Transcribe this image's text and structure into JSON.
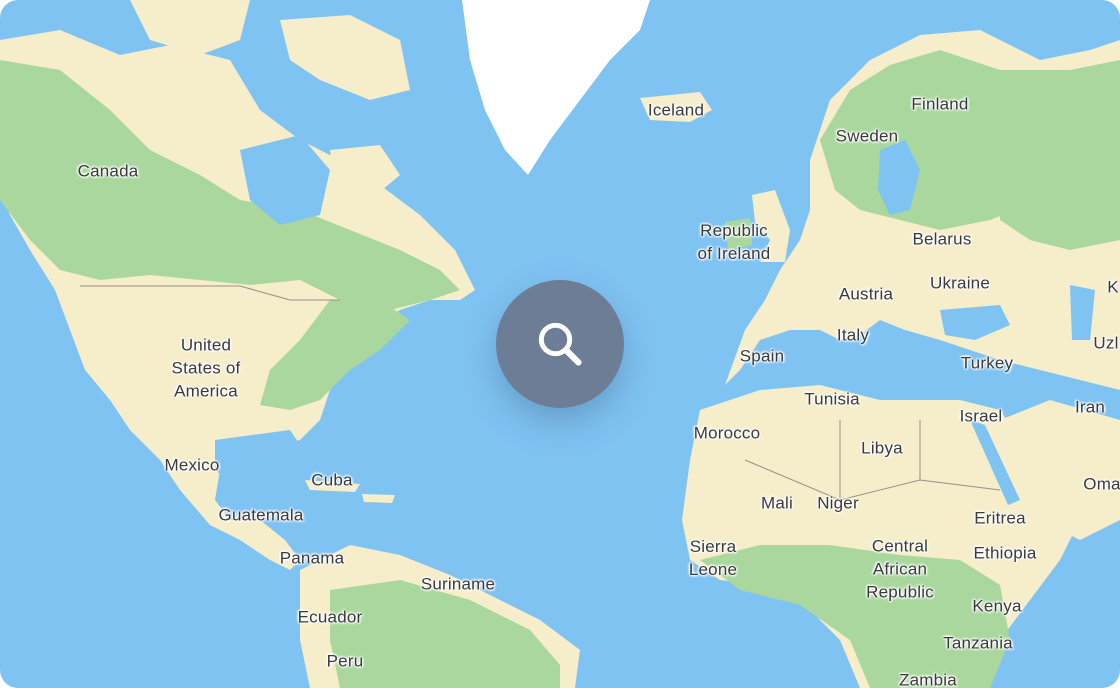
{
  "colors": {
    "ocean": "#7fc3f3",
    "land_green": "#a9d79e",
    "land_sand": "#f6edcb",
    "ice": "#ffffff",
    "search_button": "#6d7d95"
  },
  "search_button": {
    "icon": "search-icon"
  },
  "labels": {
    "canada": "Canada",
    "usa": "United\nStates of\nAmerica",
    "mexico": "Mexico",
    "cuba": "Cuba",
    "guatemala": "Guatemala",
    "panama": "Panama",
    "suriname": "Suriname",
    "ecuador": "Ecuador",
    "peru": "Peru",
    "iceland": "Iceland",
    "ireland": "Republic\nof Ireland",
    "finland": "Finland",
    "sweden": "Sweden",
    "belarus": "Belarus",
    "ukraine": "Ukraine",
    "austria": "Austria",
    "italy": "Italy",
    "spain": "Spain",
    "turkey": "Turkey",
    "tunisia": "Tunisia",
    "morocco": "Morocco",
    "libya": "Libya",
    "israel": "Israel",
    "iran": "Iran",
    "mali": "Mali",
    "niger": "Niger",
    "eritrea": "Eritrea",
    "sierra_leone": "Sierra\nLeone",
    "car": "Central\nAfrican\nRepublic",
    "ethiopia": "Ethiopia",
    "kenya": "Kenya",
    "tanzania": "Tanzania",
    "zambia": "Zambia",
    "oman": "Oma",
    "uzbekistan": "Uzl",
    "kazakhstan": "K"
  }
}
